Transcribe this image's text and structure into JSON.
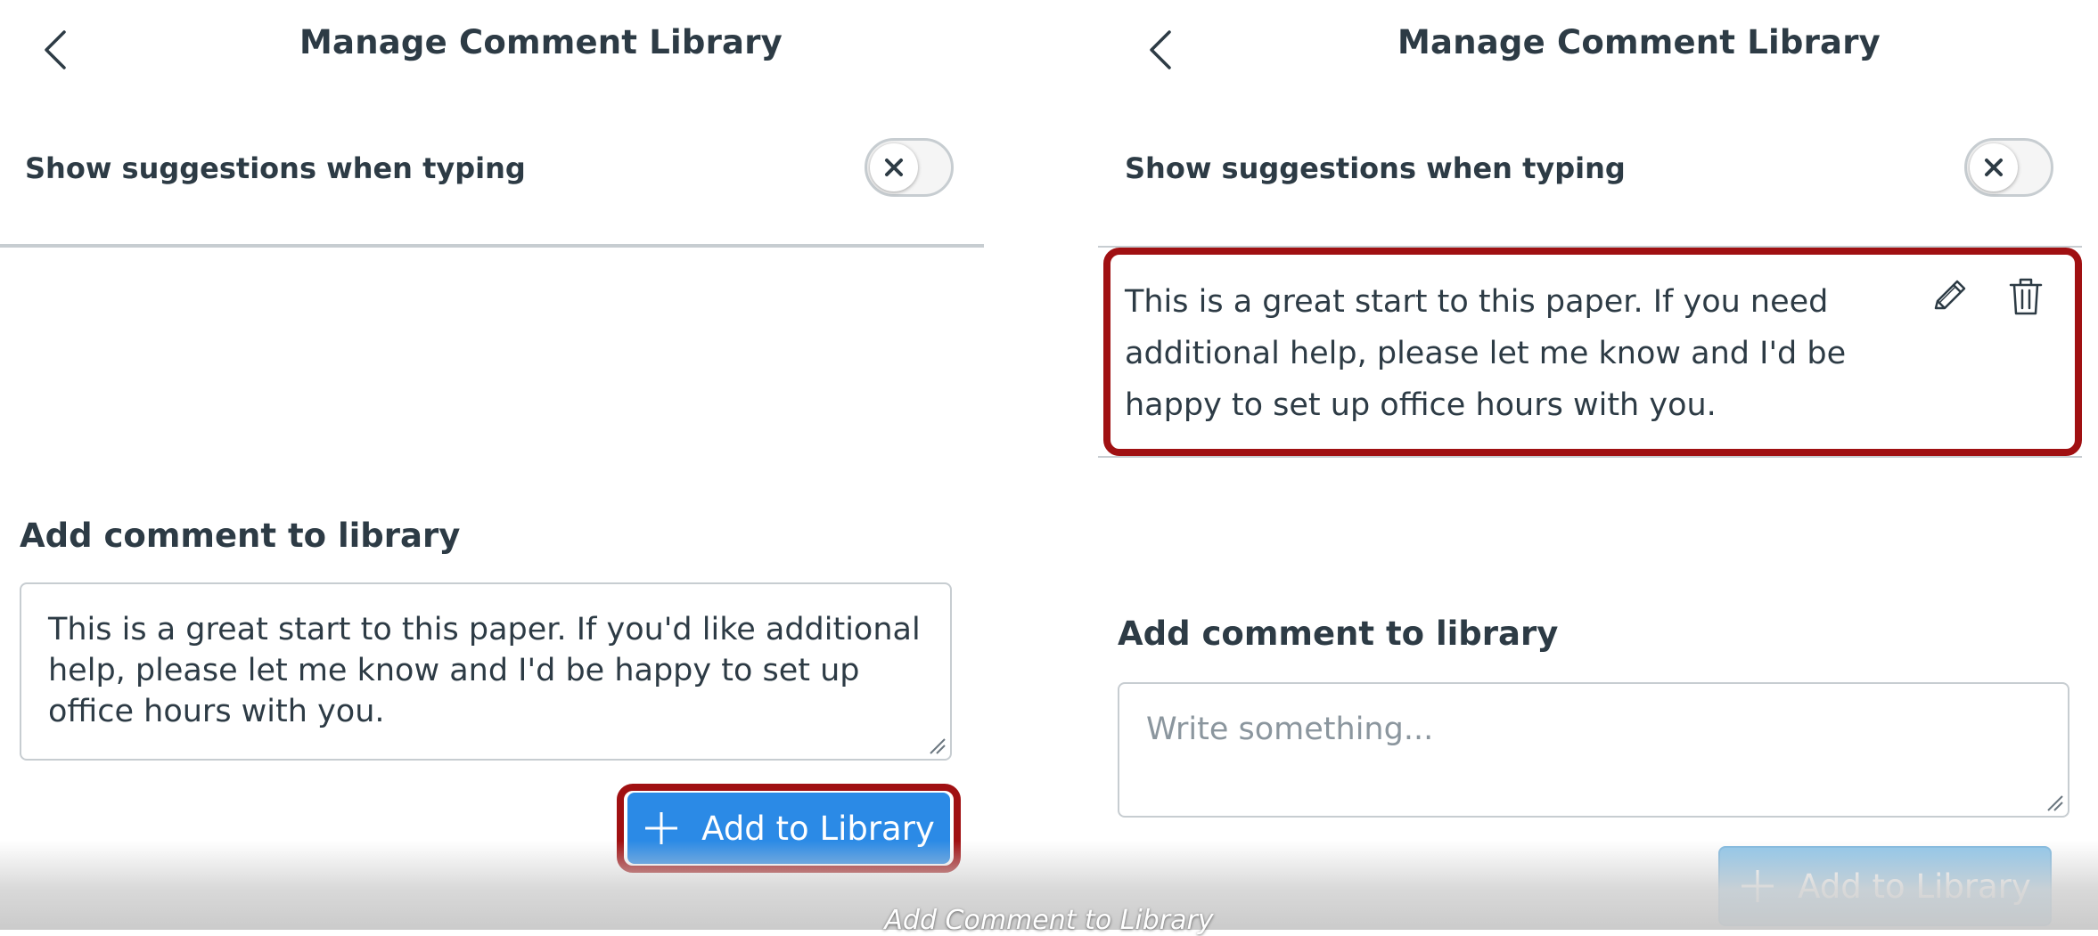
{
  "left_screen": {
    "header": {
      "title": "Manage Comment Library"
    },
    "settings": {
      "suggestions_label": "Show suggestions when typing",
      "suggestions_enabled": false
    },
    "add_section": {
      "heading": "Add comment to library",
      "comment_value": "This is a great start to this paper. If you'd like additional help, please let me know and I'd be happy to set up office hours with you.",
      "add_button_label": "Add to Library",
      "add_button_enabled": true,
      "add_button_highlighted": true
    }
  },
  "right_screen": {
    "header": {
      "title": "Manage Comment Library"
    },
    "settings": {
      "suggestions_label": "Show suggestions when typing",
      "suggestions_enabled": false
    },
    "library_items": [
      {
        "lines": [
          "This is a great start to this paper. If you need",
          "additional help, please let me know and I'd be",
          "happy to set up office hours with you."
        ],
        "highlighted": true
      }
    ],
    "add_section": {
      "heading": "Add comment to library",
      "comment_placeholder": "Write something...",
      "add_button_label": "Add to Library",
      "add_button_enabled": false
    }
  },
  "caption": "Add Comment to Library",
  "colors": {
    "primary_blue": "#2b8ae6",
    "disabled_blue": "#8fc6ea",
    "highlight_red": "#a01012",
    "text_dark": "#2d3b45",
    "placeholder_gray": "#8b969e",
    "border_gray": "#c7cdd1"
  },
  "icons": {
    "back": "chevron-left-icon",
    "toggle_off": "x-icon",
    "add": "plus-icon",
    "edit": "pencil-icon",
    "delete": "trash-icon"
  }
}
